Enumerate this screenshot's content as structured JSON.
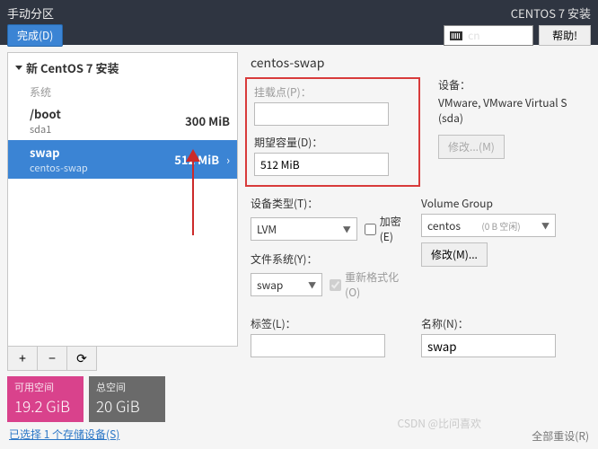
{
  "topbar": {
    "title": "手动分区",
    "done": "完成(D)",
    "install_title": "CENTOS 7 安装",
    "kb_layout": "cn",
    "help": "帮助!"
  },
  "tree": {
    "header": "新 CentOS 7 安装",
    "section": "系统",
    "items": [
      {
        "name": "/boot",
        "sub": "sda1",
        "size": "300 MiB",
        "selected": false
      },
      {
        "name": "swap",
        "sub": "centos-swap",
        "size": "512 MiB",
        "selected": true
      }
    ],
    "add": "+",
    "remove": "−",
    "reload": "⟳"
  },
  "space": {
    "avail_label": "可用空间",
    "avail_value": "19.2 GiB",
    "total_label": "总空间",
    "total_value": "20 GiB"
  },
  "storage_link": "已选择 1 个存储设备(S)",
  "form": {
    "title": "centos-swap",
    "mount_label": "挂载点(P)：",
    "mount_value": "",
    "capacity_label": "期望容量(D)：",
    "capacity_value": "512 MiB",
    "device_label": "设备：",
    "device_value": "VMware, VMware Virtual S (sda)",
    "modify1": "修改...(M)",
    "devtype_label": "设备类型(T)：",
    "devtype_value": "LVM",
    "encrypt_label": "加密(E)",
    "fs_label": "文件系统(Y)：",
    "fs_value": "swap",
    "reformat_label": "重新格式化(O)",
    "vg_label": "Volume Group",
    "vg_value": "centos",
    "vg_info": "(0 B 空闲)",
    "modify2": "修改(M)...",
    "tag_label": "标签(L)：",
    "tag_value": "",
    "name_label": "名称(N)：",
    "name_value": "swap"
  },
  "footer": {
    "reset": "全部重设(R)",
    "watermark": "CSDN @比问喜欢"
  }
}
